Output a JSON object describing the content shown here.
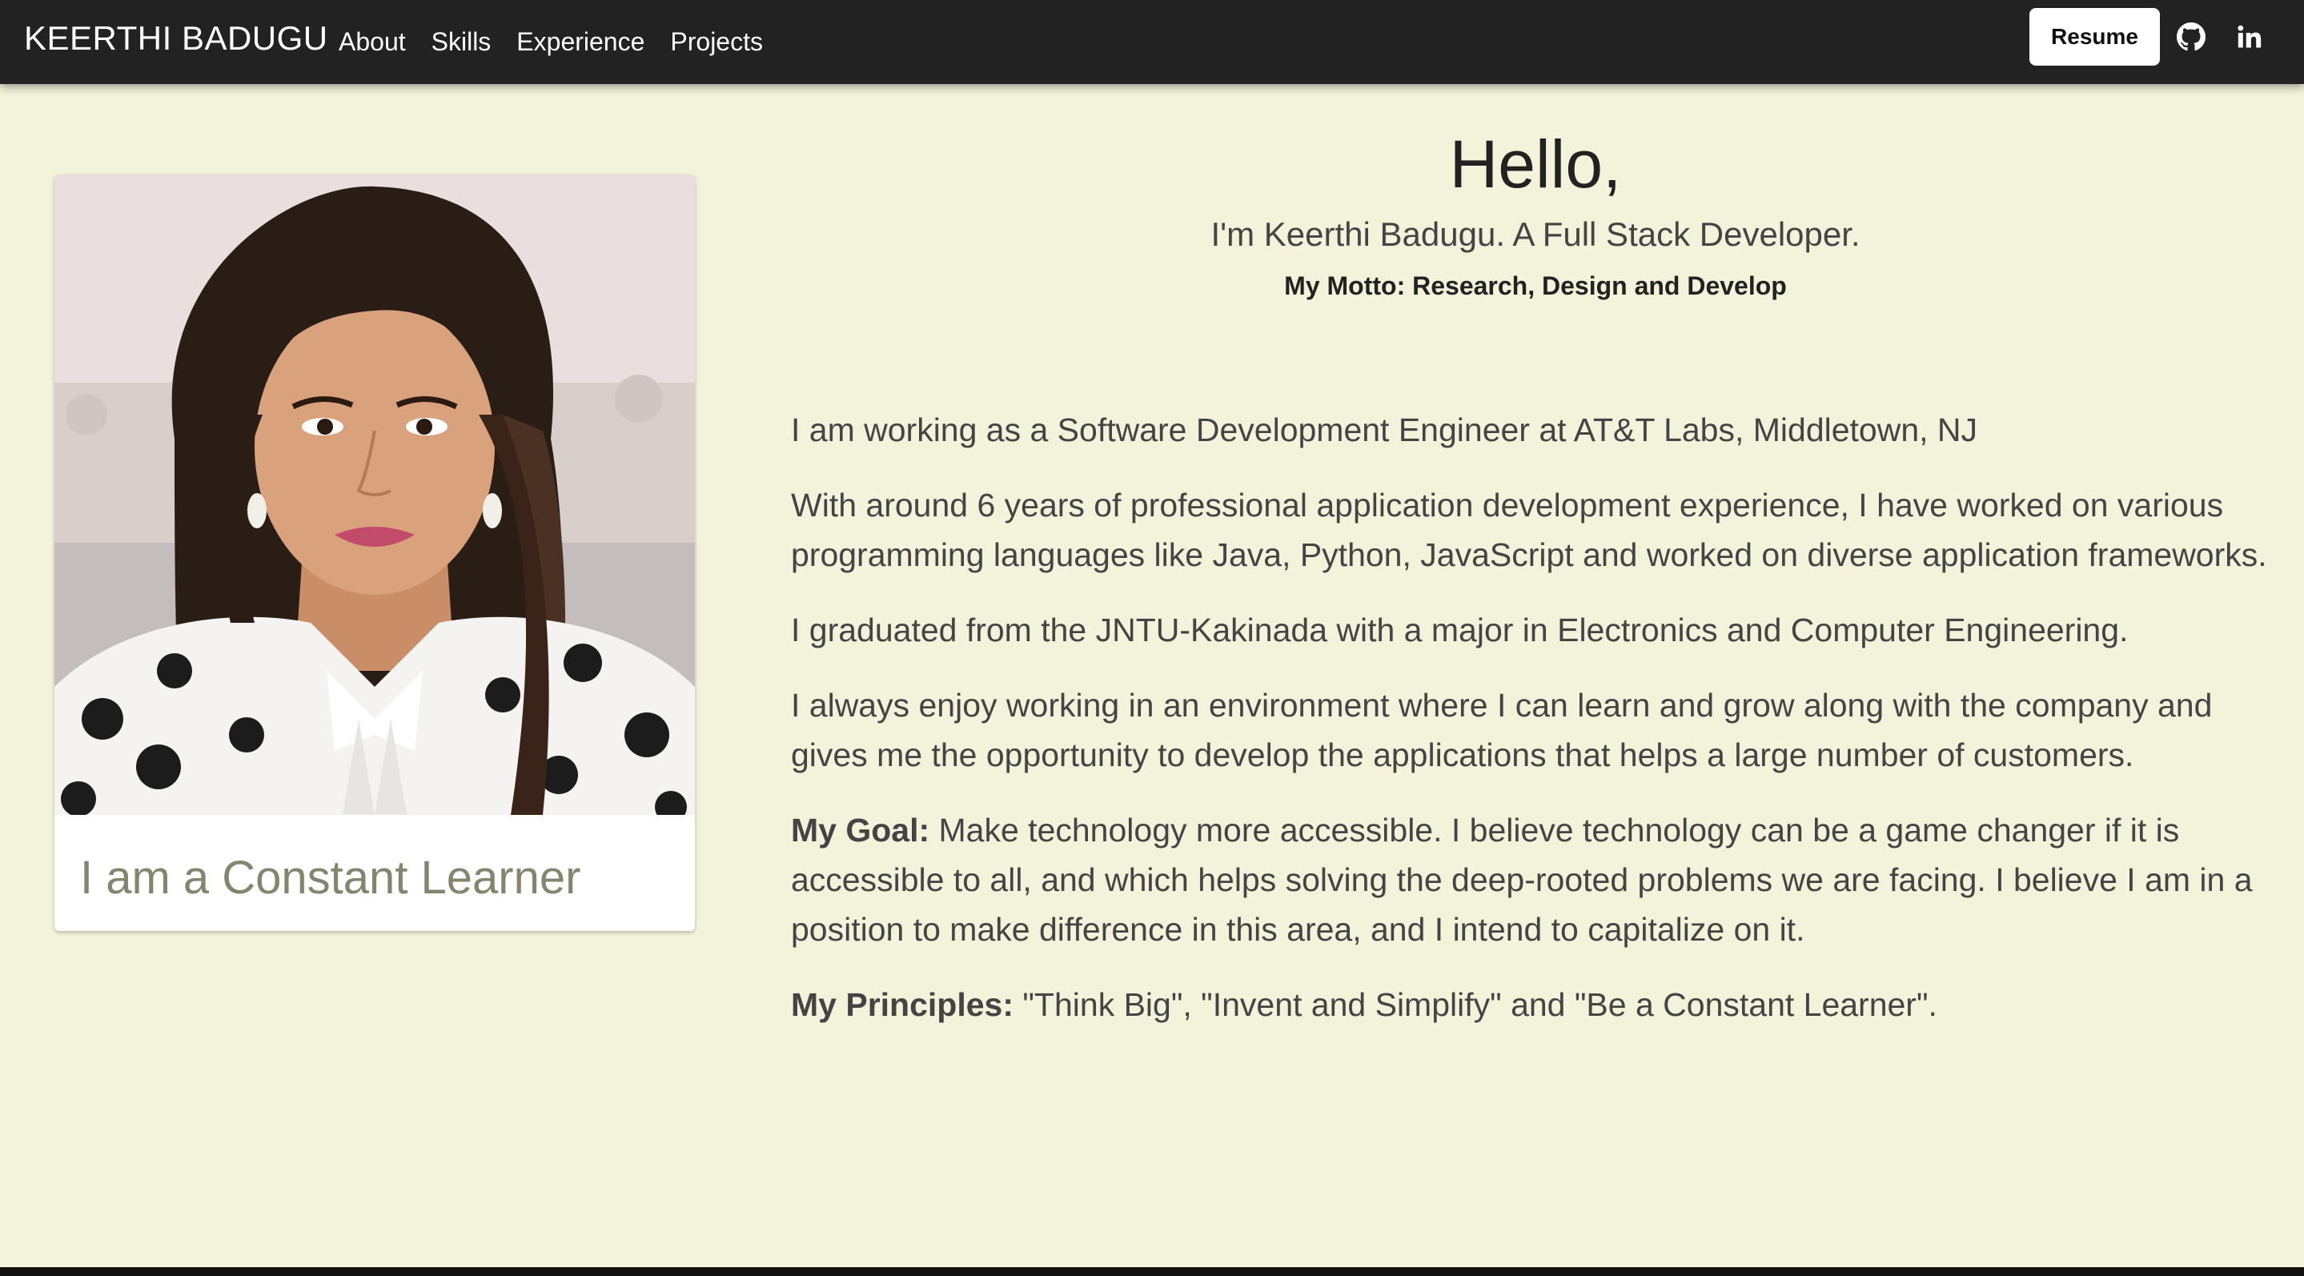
{
  "navbar": {
    "brand": "KEERTHI BADUGU",
    "links": [
      "About",
      "Skills",
      "Experience",
      "Projects"
    ],
    "resume_label": "Resume",
    "social_icons": [
      "github-icon",
      "linkedin-icon"
    ]
  },
  "card": {
    "caption": "I am a Constant Learner"
  },
  "hero": {
    "greeting": "Hello,",
    "intro": "I'm Keerthi Badugu. A Full Stack Developer.",
    "motto": "My Motto: Research, Design and Develop"
  },
  "about": {
    "p1": "I am working as a Software Development Engineer at AT&T Labs, Middletown, NJ",
    "p2": "With around 6 years of professional application development experience, I have worked on various programming languages like Java, Python, JavaScript and worked on diverse application frameworks.",
    "p3": "I graduated from the JNTU-Kakinada with a major in Electronics and Computer Engineering.",
    "p4": "I always enjoy working in an environment where I can learn and grow along with the company and gives me the opportunity to develop the applications that helps a large number of customers.",
    "goal_label": "My Goal:",
    "goal_text": " Make technology more accessible. I believe technology can be a game changer if it is accessible to all, and which helps solving the deep-rooted problems we are facing. I believe I am in a position to make difference in this area, and I intend to capitalize on it.",
    "principles_label": "My Principles:",
    "principles_text": " \"Think Big\", \"Invent and Simplify\" and \"Be a Constant Learner\"."
  },
  "colors": {
    "navbar_bg": "#222222",
    "page_bg": "#f3f3dc",
    "caption": "#85856f",
    "body_text": "#444444"
  }
}
